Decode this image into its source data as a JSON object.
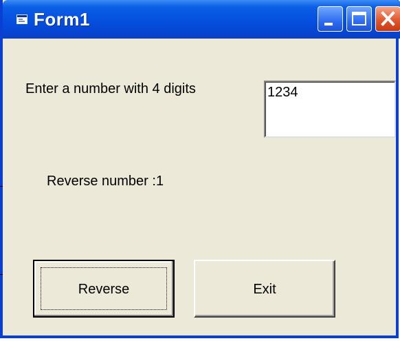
{
  "window": {
    "title": "Form1",
    "title_bar_color": "#0551e0",
    "client_color": "#ece9d8",
    "controls": {
      "minimize_icon": "minimize-icon",
      "maximize_icon": "maximize-icon",
      "close_icon": "close-icon"
    },
    "app_icon": "form-app-icon"
  },
  "form": {
    "prompt_label": "Enter a number with 4 digits",
    "number_input": {
      "value": "1234",
      "placeholder": ""
    },
    "result_label": "Reverse number :1",
    "buttons": {
      "reverse_label": "Reverse",
      "exit_label": "Exit"
    }
  }
}
